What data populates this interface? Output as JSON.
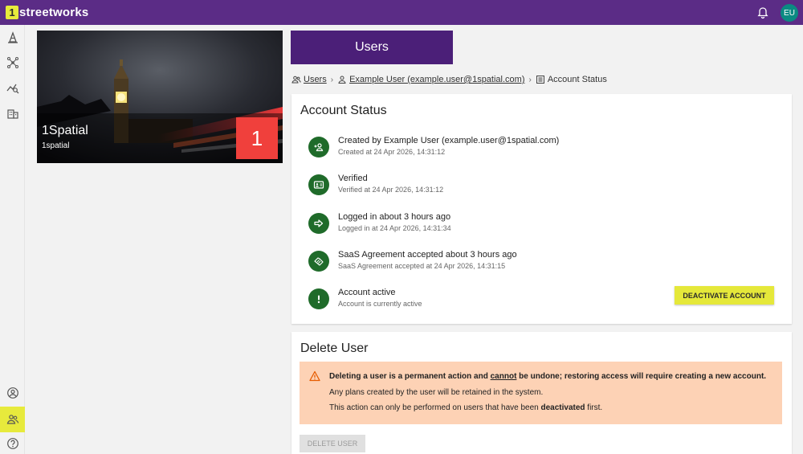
{
  "app": {
    "logo_mark": "1",
    "logo_text": "streetworks",
    "avatar_initials": "EU"
  },
  "icons": {
    "notifications": "bell-icon",
    "sidebar": [
      "road-cone-icon",
      "network-icon",
      "analytics-icon",
      "organisation-icon",
      "account-icon",
      "users-icon",
      "help-icon"
    ]
  },
  "org_card": {
    "name": "1Spatial",
    "subtitle": "1spatial",
    "badge_count": "1"
  },
  "page": {
    "title": "Users"
  },
  "breadcrumb": {
    "users": "Users",
    "user": "Example User (example.user@1spatial.com)",
    "current": "Account Status"
  },
  "account_status": {
    "title": "Account Status",
    "items": [
      {
        "main": "Created by Example User (example.user@1spatial.com)",
        "sub": "Created at 24 Apr 2026, 14:31:12",
        "icon": "person-add-icon"
      },
      {
        "main": "Verified",
        "sub": "Verified at 24 Apr 2026, 14:31:12",
        "icon": "id-card-icon"
      },
      {
        "main": "Logged in about 3 hours ago",
        "sub": "Logged in at 24 Apr 2026, 14:31:34",
        "icon": "login-arrow-icon"
      },
      {
        "main": "SaaS Agreement accepted about 3 hours ago",
        "sub": "SaaS Agreement accepted at 24 Apr 2026, 14:31:15",
        "icon": "handshake-icon"
      },
      {
        "main": "Account active",
        "sub": "Account is currently active",
        "icon": "exclamation-icon"
      }
    ],
    "deactivate_label": "DEACTIVATE ACCOUNT"
  },
  "delete_user": {
    "title": "Delete User",
    "warning_part1": "Deleting a user is a permanent action and ",
    "warning_emph": "cannot",
    "warning_part2": " be undone; restoring access will require creating a new account.",
    "line2": "Any plans created by the user will be retained in the system.",
    "line3_part1": "This action can only be performed on users that have been ",
    "line3_emph": "deactivated",
    "line3_part2": " first.",
    "button_label": "DELETE USER"
  },
  "colors": {
    "header": "#5b2c86",
    "title_bar": "#4b1f78",
    "accent": "#e5e83a",
    "status_green": "#1f6b2a",
    "badge_red": "#f0403c",
    "warning_bg": "#fdd2b5",
    "avatar": "#0b8a82"
  }
}
